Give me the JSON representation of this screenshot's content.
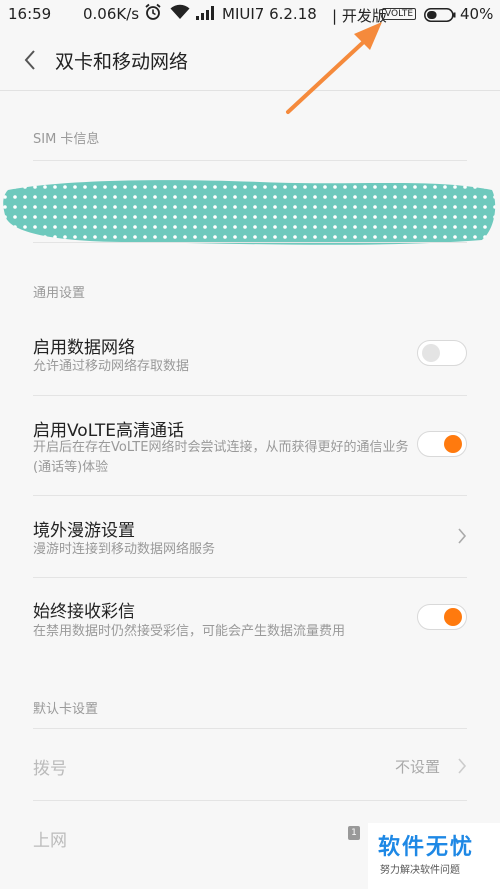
{
  "status_bar": {
    "time": "16:59",
    "speed": "0.06K/s",
    "carrier": "MIUI7 6.2.18",
    "dev_label": "| 开发版",
    "volte_badge": "VOLTE",
    "battery": "40%",
    "battery_level": 0.4
  },
  "header": {
    "title": "双卡和移动网络"
  },
  "sections": {
    "sim_info": "SIM 卡信息",
    "general": "通用设置",
    "default_card": "默认卡设置"
  },
  "rows": {
    "mobile_data": {
      "title": "启用数据网络",
      "subtitle": "允许通过移动网络存取数据",
      "enabled": false
    },
    "volte": {
      "title": "启用VoLTE高清通话",
      "subtitle": "开启后在存在VoLTE网络时会尝试连接，从而获得更好的通信业务(通话等)体验",
      "enabled": true
    },
    "roaming": {
      "title": "境外漫游设置",
      "subtitle": "漫游时连接到移动数据网络服务"
    },
    "mms": {
      "title": "始终接收彩信",
      "subtitle": "在禁用数据时仍然接受彩信，可能会产生数据流量费用",
      "enabled": true
    },
    "dial": {
      "title": "拨号",
      "value": "不设置"
    },
    "internet": {
      "title": "上网",
      "sim_badge": "1"
    }
  },
  "watermark": {
    "main": "软件无忧",
    "sub": "努力解决软件问题"
  },
  "colors": {
    "accent": "#ff7a0e",
    "annotation": "#f58a3c",
    "scribble": "#6ec9bd"
  }
}
